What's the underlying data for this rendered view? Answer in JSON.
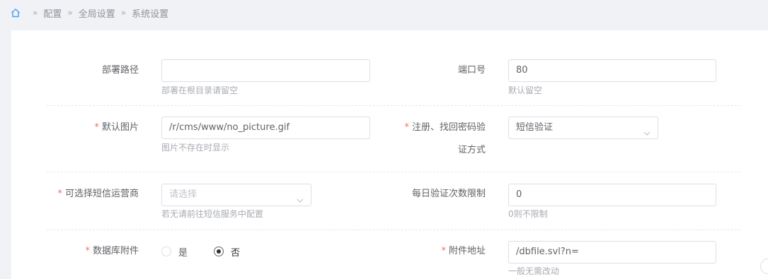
{
  "breadcrumb": {
    "home_icon": "home-icon",
    "separator": "»",
    "items": [
      "配置",
      "全局设置",
      "系统设置"
    ]
  },
  "form": {
    "deploy_path": {
      "label": "部署路径",
      "value": "",
      "hint": "部署在根目录请留空"
    },
    "port": {
      "label": "端口号",
      "value": "80",
      "hint": "默认留空"
    },
    "default_image": {
      "required_mark": "*",
      "label": "默认图片",
      "value": "/r/cms/www/no_picture.gif",
      "hint": "图片不存在时显示"
    },
    "verify_method": {
      "required_mark": "*",
      "label_line1": "注册、找回密码验",
      "label_line2": "证方式",
      "value": "短信验证"
    },
    "sms_provider": {
      "required_mark": "*",
      "label": "可选择短信运营商",
      "placeholder": "请选择",
      "hint": "若无请前往短信服务中配置"
    },
    "daily_limit": {
      "label": "每日验证次数限制",
      "value": "0",
      "hint": "0则不限制"
    },
    "db_attachment": {
      "required_mark": "*",
      "label": "数据库附件",
      "options": [
        "是",
        "否"
      ],
      "selected": "否"
    },
    "attachment_url": {
      "required_mark": "*",
      "label": "附件地址",
      "value": "/dbfile.svl?n=",
      "hint": "一般无需改动"
    }
  },
  "colors": {
    "required": "#f56c6c",
    "border": "#dcdfe6",
    "background": "#f0f2f5"
  }
}
